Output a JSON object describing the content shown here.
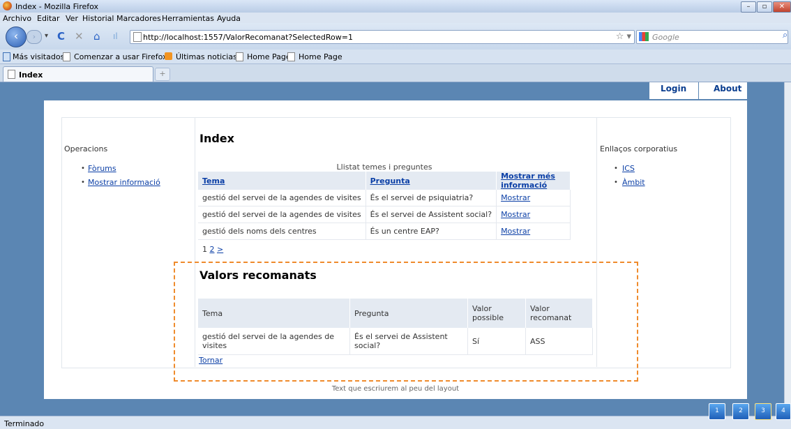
{
  "window": {
    "title": "Index - Mozilla Firefox",
    "min": "–",
    "max": "▫",
    "close": "✕"
  },
  "menu": [
    "Archivo",
    "Editar",
    "Ver",
    "Historial",
    "Marcadores",
    "Herramientas",
    "Ayuda"
  ],
  "nav": {
    "back": "‹",
    "forward": "›",
    "dropdown": "▾",
    "reload": "C",
    "stop": "✕",
    "home": "⌂",
    "signal": "ıl",
    "url": "http://localhost:1557/ValorRecomanat?SelectedRow=1",
    "bookmark_star": "☆ ▾",
    "search_placeholder": "Google",
    "search_go": "⌕"
  },
  "bookmarks": [
    "Más visitados",
    "Comenzar a usar Firefox",
    "Últimas noticias",
    "Home Page",
    "Home Page"
  ],
  "tabs": {
    "active": "Index",
    "new_tab": "+"
  },
  "topnav": {
    "login": "Login",
    "about": "About"
  },
  "left": {
    "heading": "Operacions",
    "links": [
      "Fòrums",
      "Mostrar informació"
    ]
  },
  "right": {
    "heading": "Enllaços corporatius",
    "links": [
      "ICS",
      "Àmbit"
    ]
  },
  "bullet": "•",
  "main": {
    "title": "Index",
    "table1": {
      "caption": "Llistat temes i preguntes",
      "headers": [
        "Tema",
        "Pregunta",
        "Mostrar més informació"
      ],
      "rows": [
        [
          "gestió del servei de la agendes de visites",
          "És el servei de psiquiatria?",
          "Mostrar"
        ],
        [
          "gestió del servei de la agendes de visites",
          "És el servei de Assistent social?",
          "Mostrar"
        ],
        [
          "gestió dels noms dels centres",
          "És un centre EAP?",
          "Mostrar"
        ]
      ]
    },
    "pager": {
      "current": "1",
      "page2": "2",
      "next": ">"
    },
    "section2_title": "Valors recomanats",
    "table2": {
      "headers": [
        "Tema",
        "Pregunta",
        "Valor possible",
        "Valor recomanat"
      ],
      "row": [
        "gestió del servei de la agendes de visites",
        "És el servei de Assistent social?",
        "Sí",
        "ASS"
      ]
    },
    "back_link": "Tornar"
  },
  "footer": "Text que escriurem al peu del layout",
  "status": "Terminado",
  "desktops": [
    "1",
    "2",
    "3",
    "4"
  ],
  "colors": {
    "page_bg": "#5b86b3",
    "link": "#0b3fa6",
    "highlight": "#ef8b2c"
  }
}
